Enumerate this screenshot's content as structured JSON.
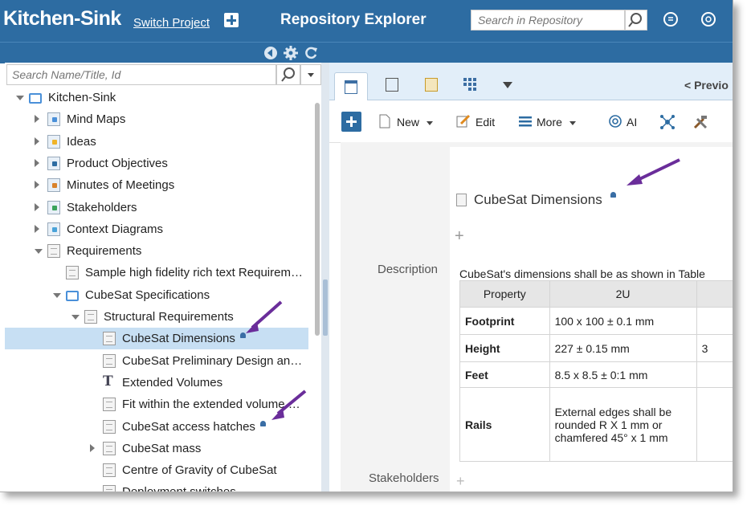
{
  "header": {
    "app_title": "Kitchen-Sink",
    "switch_project": "Switch Project",
    "page_heading": "Repository Explorer",
    "search_placeholder": "Search in Repository"
  },
  "left": {
    "search_placeholder": "Search Name/Title, Id",
    "tree": [
      {
        "label": "Kitchen-Sink",
        "indent": 0,
        "caret": "down",
        "icon": "folder-open-icon"
      },
      {
        "label": "Mind Maps",
        "indent": 1,
        "caret": "right",
        "icon": "mind-map-icon"
      },
      {
        "label": "Ideas",
        "indent": 1,
        "caret": "right",
        "icon": "idea-icon"
      },
      {
        "label": "Product Objectives",
        "indent": 1,
        "caret": "right",
        "icon": "objective-icon"
      },
      {
        "label": "Minutes of Meetings",
        "indent": 1,
        "caret": "right",
        "icon": "meeting-icon"
      },
      {
        "label": "Stakeholders",
        "indent": 1,
        "caret": "right",
        "icon": "stakeholder-icon"
      },
      {
        "label": "Context Diagrams",
        "indent": 1,
        "caret": "right",
        "icon": "diagram-icon"
      },
      {
        "label": "Requirements",
        "indent": 1,
        "caret": "down",
        "icon": "requirements-icon"
      },
      {
        "label": "Sample high fidelity rich text Requirement",
        "indent": 2,
        "caret": "none",
        "icon": "document-icon"
      },
      {
        "label": "CubeSat Specifications",
        "indent": 2,
        "caret": "down",
        "icon": "folder-icon"
      },
      {
        "label": "Structural Requirements",
        "indent": 3,
        "caret": "down",
        "icon": "package-icon"
      },
      {
        "label": "CubeSat Dimensions",
        "indent": 4,
        "caret": "none",
        "icon": "document-icon",
        "selected": true,
        "bell": true
      },
      {
        "label": "CubeSat Preliminary Design and Analysis",
        "indent": 4,
        "caret": "none",
        "icon": "document-icon"
      },
      {
        "label": "Extended Volumes",
        "indent": 4,
        "caret": "none",
        "icon": "text-icon"
      },
      {
        "label": "Fit within the extended volume of the deployer",
        "indent": 4,
        "caret": "none",
        "icon": "document-icon"
      },
      {
        "label": "CubeSat access hatches",
        "indent": 4,
        "caret": "none",
        "icon": "document-icon",
        "bell": true
      },
      {
        "label": "CubeSat mass",
        "indent": 4,
        "caret": "right",
        "icon": "document-icon"
      },
      {
        "label": "Centre of Gravity of CubeSat",
        "indent": 4,
        "caret": "none",
        "icon": "document-icon"
      },
      {
        "label": "Deployment switches",
        "indent": 4,
        "caret": "none",
        "icon": "document-icon"
      }
    ]
  },
  "right": {
    "prev_label": "< Previo",
    "toolbar": {
      "new": "New",
      "edit": "Edit",
      "more": "More",
      "ai": "AI"
    },
    "doc_title": "CubeSat Dimensions",
    "description_label": "Description",
    "description_text": "CubeSat's dimensions shall be as shown in Table",
    "table": {
      "headers": [
        "Property",
        "2U"
      ],
      "rows": [
        {
          "property": "Footprint",
          "value": "100 x 100 ± 0.1 mm",
          "extra": ""
        },
        {
          "property": "Height",
          "value": "227 ± 0.15 mm",
          "extra": "3"
        },
        {
          "property": "Feet",
          "value": "8.5 x 8.5 ± 0:1 mm",
          "extra": ""
        },
        {
          "property": "Rails",
          "value": "External edges shall be rounded R X 1 mm or chamfered 45° x 1 mm",
          "extra": ""
        }
      ]
    },
    "stakeholders_label": "Stakeholders"
  },
  "colors": {
    "brand": "#2d6ca2",
    "selection": "#c7dff3",
    "annotation_arrow": "#6a2d9a"
  }
}
